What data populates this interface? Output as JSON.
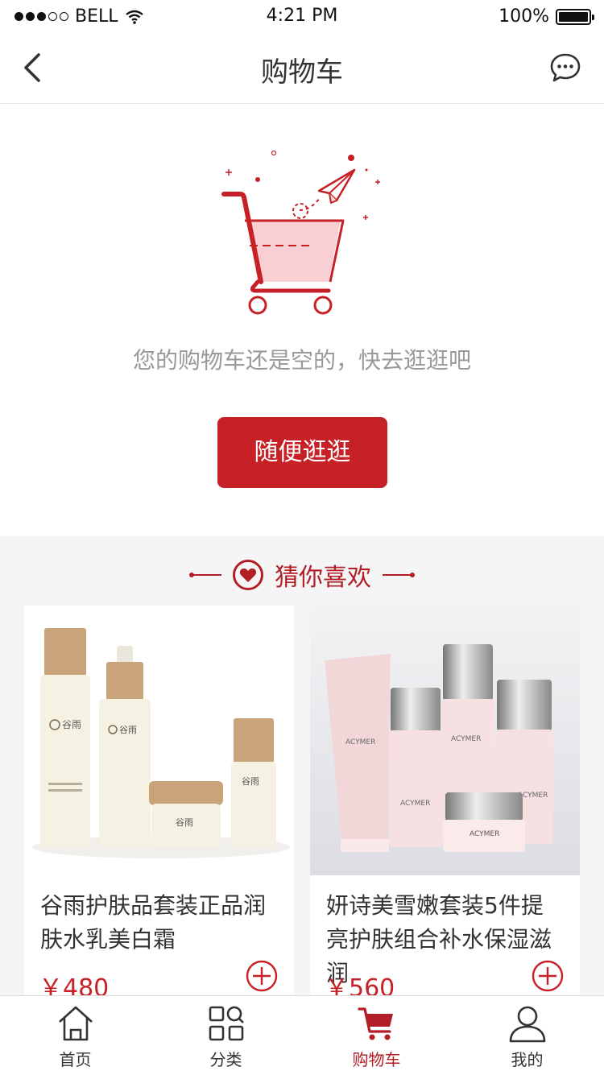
{
  "status_bar": {
    "carrier": "BELL",
    "time": "4:21 PM",
    "battery": "100%"
  },
  "nav": {
    "title": "购物车",
    "back_icon": "chevron-left-icon",
    "chat_icon": "chat-bubble-icon"
  },
  "empty_state": {
    "message": "您的购物车还是空的，快去逛逛吧",
    "button_label": "随便逛逛",
    "accent": "#c62127"
  },
  "recommend": {
    "title": "猜你喜欢",
    "products": [
      {
        "name": "谷雨护肤品套装正品润肤水乳美白霜",
        "price": "￥480",
        "image_brand": "谷雨"
      },
      {
        "name": "妍诗美雪嫩套装5件提亮护肤组合补水保湿滋润",
        "price": "￥560",
        "image_brand": "ACYMER"
      }
    ]
  },
  "tabbar": {
    "items": [
      {
        "label": "首页",
        "icon": "home-icon"
      },
      {
        "label": "分类",
        "icon": "category-grid-icon"
      },
      {
        "label": "购物车",
        "icon": "cart-icon",
        "active": true
      },
      {
        "label": "我的",
        "icon": "profile-icon"
      }
    ]
  }
}
